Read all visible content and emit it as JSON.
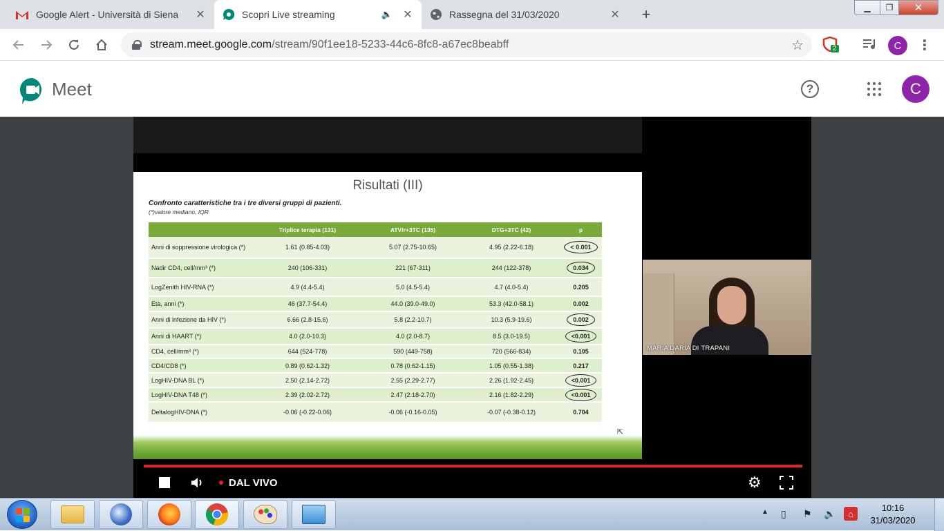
{
  "browser": {
    "tabs": [
      {
        "title": "Google Alert - Università di Siena",
        "icon": "gmail-icon",
        "active": false
      },
      {
        "title": "Scopri Live streaming",
        "icon": "meet-icon",
        "active": true
      },
      {
        "title": "Rassegna del 31/03/2020",
        "icon": "globe-icon",
        "active": false
      }
    ],
    "new_tab": "+",
    "url_host": "stream.meet.google.com",
    "url_path": "/stream/90f1ee18-5233-44c6-8fc8-a67ec8beabff",
    "ext_badge": "2",
    "profile_initial": "C"
  },
  "meet": {
    "app_name": "Meet",
    "help": "?",
    "account_initial": "C",
    "accent_color": "#8e24aa"
  },
  "slide": {
    "title": "Risultati (III)",
    "subtitle": "Confronto caratteristiche tra i tre diversi gruppi di pazienti.",
    "note": "(*)valore mediano, IQR",
    "columns": [
      "",
      "Triplice terapia (131)",
      "ATV/r+3TC (135)",
      "DTG+3TC (42)",
      "p"
    ],
    "rows": [
      {
        "label": "Anni di soppressione virologica (*)",
        "a": "1.61 (0.85-4.03)",
        "b": "5.07 (2.75-10.65)",
        "c": "4.95 (2.22-6.18)",
        "p": "< 0.001",
        "circled": true
      },
      {
        "label": "Nadir CD4, cell/mm³ (*)",
        "a": "240 (106-331)",
        "b": "221 (67-311)",
        "c": "244 (122-378)",
        "p": "0.034",
        "circled": true
      },
      {
        "label": "LogZenith HIV-RNA (*)",
        "a": "4.9 (4.4-5.4)",
        "b": "5.0 (4.5-5.4)",
        "c": "4.7 (4.0-5.4)",
        "p": "0.205",
        "circled": false
      },
      {
        "label": "Età, anni (*)",
        "a": "46 (37.7-54.4)",
        "b": "44.0 (39.0-49.0)",
        "c": "53.3 (42.0-58.1)",
        "p": "0.002",
        "circled": false
      },
      {
        "label": "Anni di infezione da HIV (*)",
        "a": "6.66 (2.8-15.6)",
        "b": "5.8 (2.2-10.7)",
        "c": "10.3 (5.9-19.6)",
        "p": "0.002",
        "circled": true
      },
      {
        "label": "Anni di HAART (*)",
        "a": "4.0 (2.0-10.3)",
        "b": "4.0 (2.0-8.7)",
        "c": "8.5 (3.0-19.5)",
        "p": "<0.001",
        "circled": true
      },
      {
        "label": "CD4, cell/mm³ (*)",
        "a": "644 (524-778)",
        "b": "590 (449-758)",
        "c": "720 (566-834)",
        "p": "0.105",
        "circled": false
      },
      {
        "label": "CD4/CD8 (*)",
        "a": "0.89 (0.62-1.32)",
        "b": "0.78 (0.62-1.15)",
        "c": "1.05 (0.55-1.38)",
        "p": "0.217",
        "circled": false
      },
      {
        "label": "LogHIV-DNA BL (*)",
        "a": "2.50 (2.14-2.72)",
        "b": "2.55 (2.29-2.77)",
        "c": "2.26 (1.92-2.45)",
        "p": "<0.001",
        "circled": true
      },
      {
        "label": "LogHIV-DNA T48 (*)",
        "a": "2.39 (2.02-2.72)",
        "b": "2.47 (2.18-2.70)",
        "c": "2.16 (1.82-2.29)",
        "p": "<0.001",
        "circled": true
      },
      {
        "label": "DeltalogHIV-DNA (*)",
        "a": "-0.06 (-0.22-0.06)",
        "b": "-0.06 (-0.16-0.05)",
        "c": "-0.07 (-0.38-0.12)",
        "p": "0.704",
        "circled": false
      }
    ]
  },
  "camera": {
    "speaker_name": "MARIA DARIA DI TRAPANI"
  },
  "player": {
    "live_label": "DAL VIVO",
    "live_color": "#e52222"
  },
  "taskbar": {
    "time": "10:16",
    "date": "31/03/2020"
  }
}
